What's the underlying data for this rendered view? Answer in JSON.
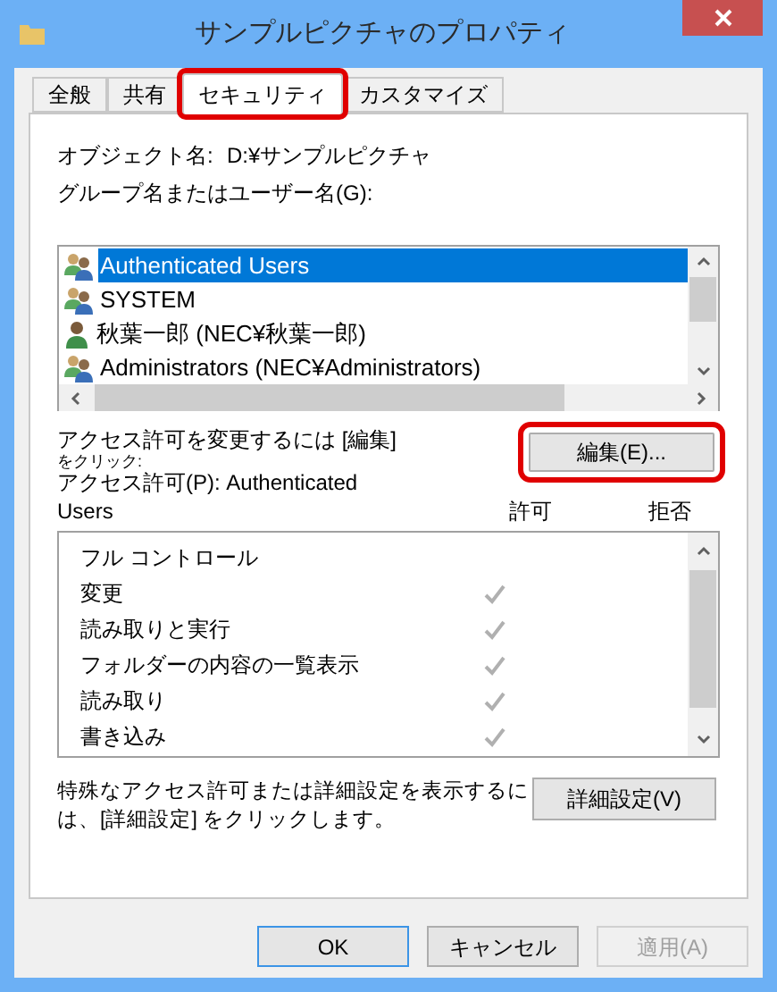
{
  "window": {
    "title": "サンプルピクチャのプロパティ"
  },
  "tabs": [
    {
      "label": "全般",
      "selected": false,
      "highlighted": false
    },
    {
      "label": "共有",
      "selected": false,
      "highlighted": false
    },
    {
      "label": "セキュリティ",
      "selected": true,
      "highlighted": true
    },
    {
      "label": "カスタマイズ",
      "selected": false,
      "highlighted": false
    }
  ],
  "object_name": {
    "label": "オブジェクト名:",
    "value": "D:¥サンプルピクチャ"
  },
  "users_label": "グループ名またはユーザー名(G):",
  "users": [
    {
      "name": "Authenticated Users",
      "kind": "group",
      "selected": true
    },
    {
      "name": "SYSTEM",
      "kind": "group",
      "selected": false
    },
    {
      "name": "秋葉一郎 (NEC¥秋葉一郎)",
      "kind": "user",
      "selected": false
    },
    {
      "name": "Administrators (NEC¥Administrators)",
      "kind": "group",
      "selected": false
    }
  ],
  "edit_hint": [
    "アクセス許可を変更するには [編集]",
    "をクリック:"
  ],
  "edit_button": {
    "label": "編集(E)...",
    "highlighted": true
  },
  "permissions_label": [
    "アクセス許可(P): Authenticated",
    "Users"
  ],
  "columns": [
    "許可",
    "拒否"
  ],
  "permissions": [
    {
      "name": "フル コントロール",
      "allow": false
    },
    {
      "name": "変更",
      "allow": true
    },
    {
      "name": "読み取りと実行",
      "allow": true
    },
    {
      "name": "フォルダーの内容の一覧表示",
      "allow": true
    },
    {
      "name": "読み取り",
      "allow": true
    },
    {
      "name": "書き込み",
      "allow": true
    }
  ],
  "advanced_hint": [
    "特殊なアクセス許可または詳細設定を表示するに",
    "は、[詳細設定] をクリックします。"
  ],
  "advanced_button": "詳細設定(V)",
  "buttons": [
    {
      "label": "OK",
      "default": true,
      "disabled": false
    },
    {
      "label": "キャンセル",
      "default": false,
      "disabled": false
    },
    {
      "label": "適用(A)",
      "default": false,
      "disabled": true
    }
  ]
}
